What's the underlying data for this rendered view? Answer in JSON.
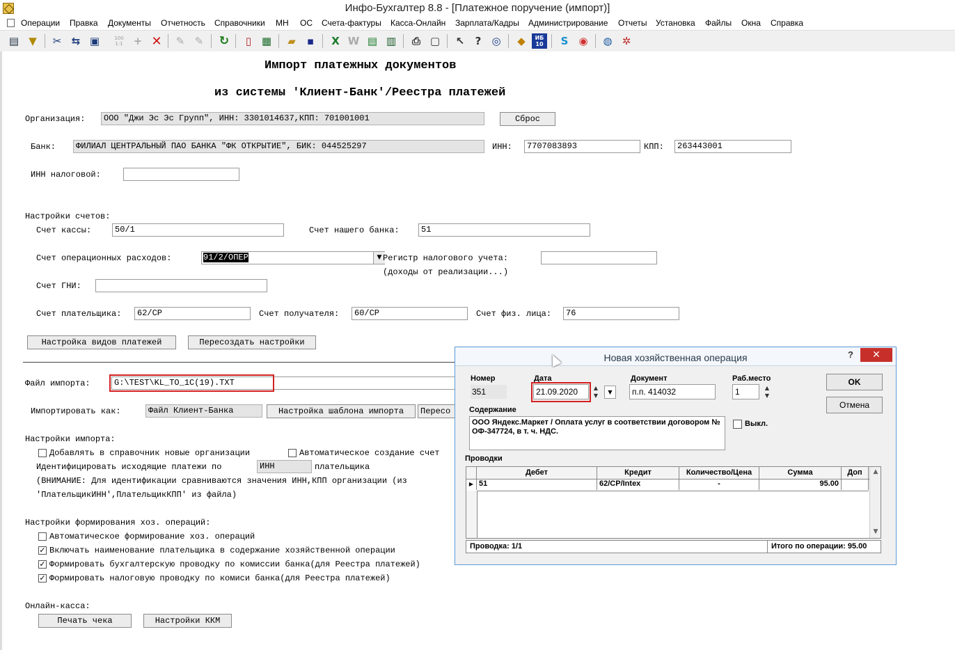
{
  "window": {
    "title": "Инфо-Бухгалтер 8.8 - [Платежное поручение (импорт)]"
  },
  "menu": [
    "Операции",
    "Правка",
    "Документы",
    "Отчетность",
    "Справочники",
    "МН",
    "ОС",
    "Счета-фактуры",
    "Касса-Онлайн",
    "Зарплата/Кадры",
    "Администрирование",
    "Отчеты",
    "Установка",
    "Файлы",
    "Окна",
    "Справка"
  ],
  "toolbar": {
    "zoom_icon_label": "100\n1:1",
    "ib_icon_label": "ИБ\n10"
  },
  "form": {
    "title_line1": "Импорт платежных документов",
    "title_line2": "из системы 'Клиент-Банк'/Реестра платежей",
    "org_label": "Организация:",
    "org_value": "ООО \"Джи Эс Эс Групп\", ИНН: 3301014637,КПП: 701001001",
    "reset_button": "Сброс",
    "bank_label": "Банк:",
    "bank_value": "ФИЛИАЛ ЦЕНТРАЛЬНЫЙ ПАО БАНКА \"ФК ОТКРЫТИЕ\", БИК: 044525297",
    "inn_label": "ИНН:",
    "inn_value": "7707083893",
    "kpp_label": "КПП:",
    "kpp_value": "263443001",
    "tax_inn_label": "ИНН налоговой:",
    "tax_inn_value": "",
    "accounts_section": "Настройки счетов:",
    "cash_account_label": "Счет кассы:",
    "cash_account_value": "50/1",
    "bank_account_label": "Счет нашего банка:",
    "bank_account_value": "51",
    "op_expense_label": "Счет операционных расходов:",
    "op_expense_value": "91/2/ОПЕР",
    "tax_register_label": "Регистр налогового учета:",
    "tax_register_hint": "(доходы от реализации...)",
    "tax_register_value": "",
    "gni_label": "Счет ГНИ:",
    "gni_value": "",
    "payer_account_label": "Счет плательщика:",
    "payer_account_value": "62/СР",
    "recipient_account_label": "Счет получателя:",
    "recipient_account_value": "60/СР",
    "person_account_label": "Счет физ. лица:",
    "person_account_value": "76",
    "payment_types_button": "Настройка видов платежей",
    "recreate_button": "Пересоздать настройки",
    "import_file_label": "Файл импорта:",
    "import_file_value": "G:\\TEST\\KL_TO_1C(19).TXT",
    "import_as_label": "Импортировать как:",
    "import_as_value": "Файл Клиент-Банка",
    "template_button": "Настройка шаблона импорта",
    "next_button": "Пересо",
    "import_settings_section": "Настройки импорта:",
    "add_orgs_label": "Добавлять в справочник новые организации",
    "auto_create_label": "Автоматическое создание счет",
    "identify_label": "Идентифицировать исходящие платежи по",
    "identify_value": "ИНН",
    "identify_suffix": "плательщика",
    "warning_line1": "(ВНИМАНИЕ: Для идентификации сравниваются значения ИНН,КПП организации (из",
    "warning_line2": "'ПлательщикИНН',ПлательщикКПП' из файла)",
    "ops_section": "Настройки формирования хоз. операций:",
    "auto_ops_label": "Автоматическое формирование хоз. операций",
    "include_payer_label": "Включать наименование плательщика в содержание хозяйственной операции",
    "bank_fee_acc_label": "Формировать бухгалтерскую проводку по комиссии банка(для Реестра платежей)",
    "bank_fee_tax_label": "Формировать налоговую проводку по комиси банка(для Реестра платежей)",
    "online_section": "Онлайн-касса:",
    "print_check_button": "Печать чека",
    "kkm_button": "Настройки ККМ"
  },
  "dialog": {
    "title": "Новая хозяйственная операция",
    "help": "?",
    "number_label": "Номер",
    "number_value": "351",
    "date_label": "Дата",
    "date_value": "21.09.2020",
    "document_label": "Документ",
    "document_value": "п.п. 414032",
    "workplace_label": "Раб.место",
    "workplace_value": "1",
    "ok_button": "OK",
    "cancel_button": "Отмена",
    "content_label": "Содержание",
    "content_value": "ООО Яндекс.Маркет / Оплата услуг в соответствии договором № ОФ-347724, в т. ч. НДС.",
    "off_label": "Выкл.",
    "entries_label": "Проводки",
    "columns": [
      "Дебет",
      "Кредит",
      "Количество/Цена",
      "Сумма",
      "Доп"
    ],
    "row": {
      "debit": "51",
      "credit": "62/СР/Intex",
      "qty": "-",
      "sum": "95.00",
      "extra": ""
    },
    "status_left": "Проводка: 1/1",
    "status_right": "Итого по операции: 95.00"
  }
}
